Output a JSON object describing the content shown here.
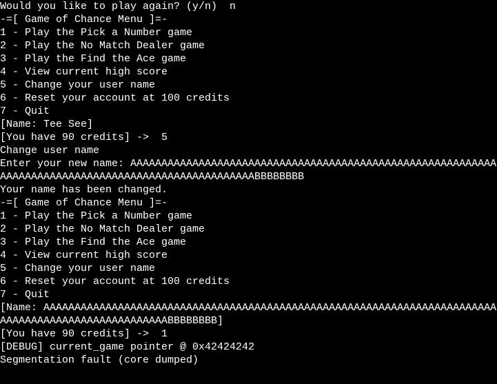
{
  "lines": [
    "Would you like to play again? (y/n)  n",
    "-=[ Game of Chance Menu ]=-",
    "1 - Play the Pick a Number game",
    "2 - Play the No Match Dealer game",
    "3 - Play the Find the Ace game",
    "4 - View current high score",
    "5 - Change your user name",
    "6 - Reset your account at 100 credits",
    "7 - Quit",
    "[Name: Tee See]",
    "[You have 90 credits] ->  5",
    "",
    "Change user name",
    "Enter your new name: AAAAAAAAAAAAAAAAAAAAAAAAAAAAAAAAAAAAAAAAAAAAAAAAAAAAAAAAAAAAAAAAAAAAAAAAAAAAAAAAAAAAAAAAAAAAAAAAAAAABBBBBBBB",
    "Your name has been changed.",
    "",
    "-=[ Game of Chance Menu ]=-",
    "1 - Play the Pick a Number game",
    "2 - Play the No Match Dealer game",
    "3 - Play the Find the Ace game",
    "4 - View current high score",
    "5 - Change your user name",
    "6 - Reset your account at 100 credits",
    "7 - Quit",
    "[Name: AAAAAAAAAAAAAAAAAAAAAAAAAAAAAAAAAAAAAAAAAAAAAAAAAAAAAAAAAAAAAAAAAAAAAAAAAAAAAAAAAAAAAAAAAAAAAAAAAAAABBBBBBBB]",
    "[You have 90 credits] ->  1",
    "",
    "[DEBUG] current_game pointer @ 0x42424242",
    "Segmentation fault (core dumped)"
  ]
}
